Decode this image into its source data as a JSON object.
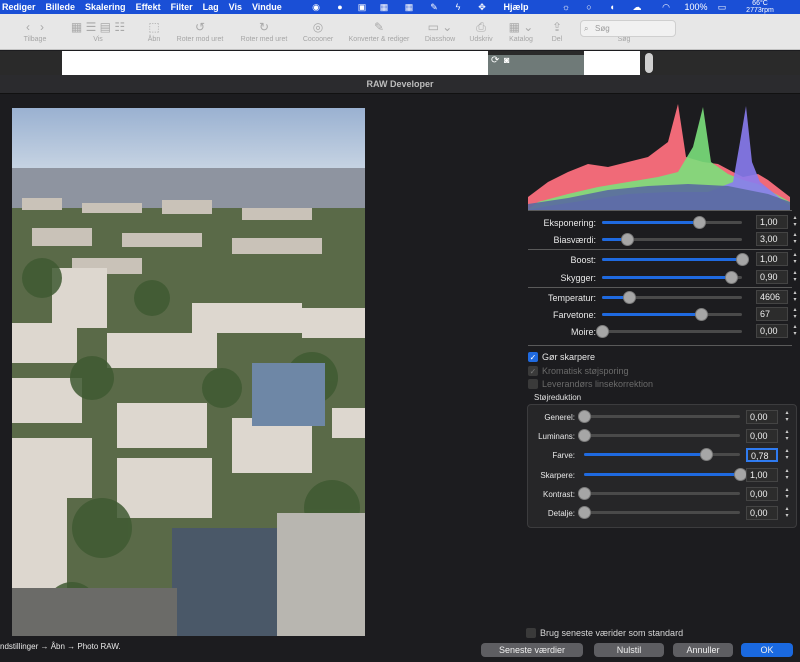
{
  "menubar": {
    "items": [
      "Rediger",
      "Billede",
      "Skalering",
      "Effekt",
      "Filter",
      "Lag",
      "Vis",
      "Vindue"
    ],
    "help": "Hjælp",
    "battery": "100%",
    "temp": "66°C",
    "rpm": "2773rpm"
  },
  "toolbar": {
    "back": "Tilbage",
    "view": "Vis",
    "open": "Åbn",
    "rotate_left": "Roter mod uret",
    "rotate_right": "Roter med uret",
    "cocooner": "Cocooner",
    "convert": "Konverter & rediger",
    "slideshow": "Diasshow",
    "print": "Udskriv",
    "catalog": "Katalog",
    "share": "Del",
    "search_label": "Søg",
    "search_placeholder": "Søg"
  },
  "dialog": {
    "title": "RAW Developer"
  },
  "sliders": [
    {
      "label": "Eksponering:",
      "value": "1,00",
      "pos": 0.69
    },
    {
      "label": "Biasværdi:",
      "value": "3,00",
      "pos": 0.18
    },
    {
      "label": "Boost:",
      "value": "1,00",
      "pos": 1.0
    },
    {
      "label": "Skygger:",
      "value": "0,90",
      "pos": 0.92
    },
    {
      "label": "Temperatur:",
      "value": "4606",
      "pos": 0.19
    },
    {
      "label": "Farvetone:",
      "value": "67",
      "pos": 0.71
    },
    {
      "label": "Moire:",
      "value": "0,00",
      "pos": 0.0
    }
  ],
  "checks": {
    "sharpen": "Gør skarpere",
    "chroma": "Kromatisk støjsporing",
    "lens": "Leverandørs linsekorrektion"
  },
  "noise": {
    "title": "Støjreduktion",
    "rows": [
      {
        "label": "Generel:",
        "value": "0,00",
        "pos": 0.0
      },
      {
        "label": "Luminans:",
        "value": "0,00",
        "pos": 0.0
      },
      {
        "label": "Farve:",
        "value": "0,78",
        "pos": 0.78
      },
      {
        "label": "Skarpere:",
        "value": "1,00",
        "pos": 1.0
      },
      {
        "label": "Kontrast:",
        "value": "0,00",
        "pos": 0.0
      },
      {
        "label": "Detalje:",
        "value": "0,00",
        "pos": 0.0
      }
    ]
  },
  "bottom": {
    "path_text": "ndstillinger → Åbn → Photo RAW.",
    "use_last": "Brug seneste værider som standard",
    "latest": "Seneste værdier",
    "reset": "Nulstil",
    "cancel": "Annuller",
    "ok": "OK"
  }
}
